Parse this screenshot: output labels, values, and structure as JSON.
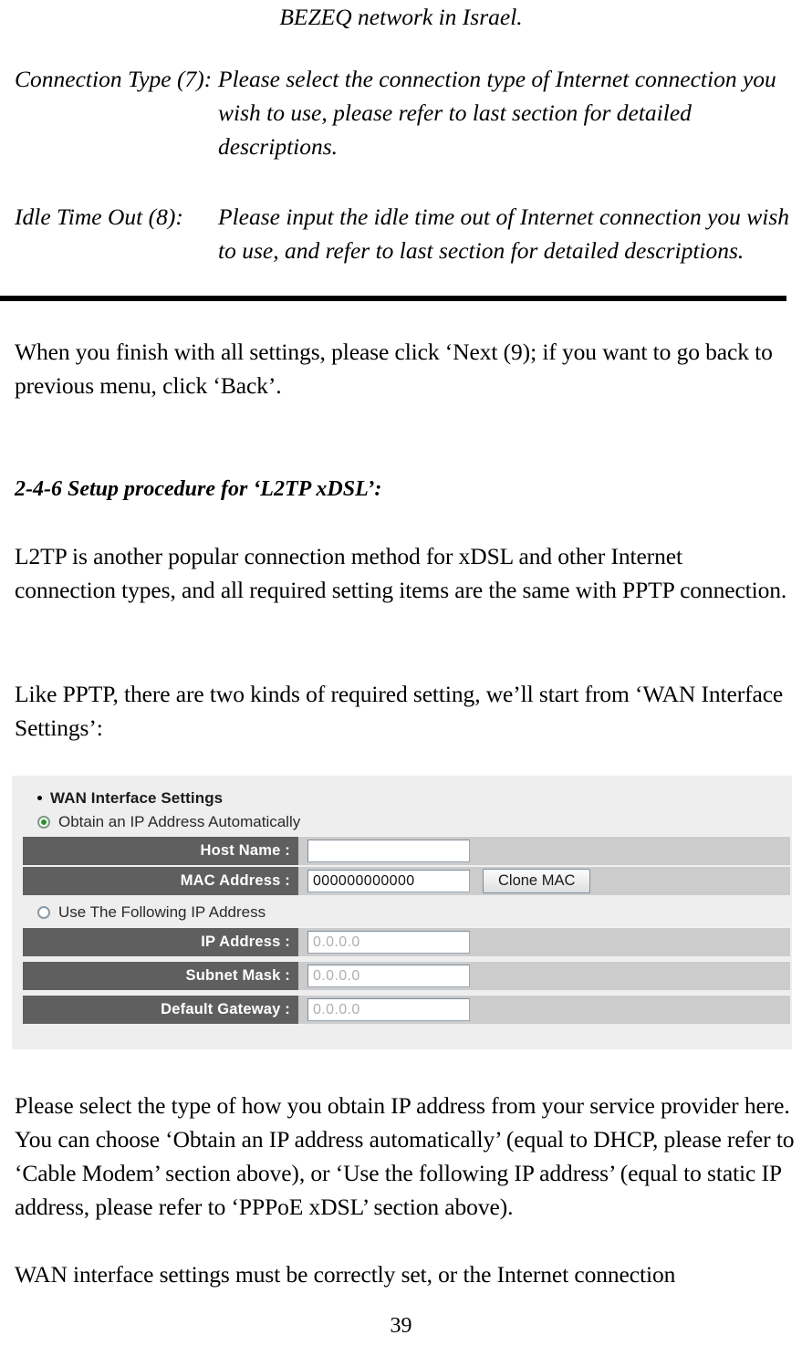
{
  "document": {
    "top_center_line": "BEZEQ network in Israel.",
    "definitions": [
      {
        "term": "Connection Type (7):",
        "description": "Please select the connection type of Internet connection you wish to use, please refer to last section for detailed descriptions."
      },
      {
        "term": "Idle Time Out (8):",
        "description": "Please input the idle time out of Internet connection you wish to use, and refer to last section for detailed descriptions."
      }
    ],
    "paragraph_after_rule": "When you finish with all settings, please click ‘Next (9); if you want to go back to previous menu, click ‘Back’.",
    "section_heading": "2-4-6 Setup procedure for ‘L2TP xDSL’:",
    "paragraph_intro": "L2TP is another popular connection method for xDSL and other Internet connection types, and all required setting items are the same with PPTP connection.",
    "paragraph_like_pptp": "Like PPTP, there are two kinds of required setting, we’ll start from ‘WAN Interface Settings’:",
    "paragraph_explain": "Please select the type of how you obtain IP address from your service provider here. You can choose ‘Obtain an IP address automatically’ (equal to DHCP, please refer to ‘Cable Modem’ section above), or ‘Use the following IP address’ (equal to static IP address, please refer to ‘PPPoE xDSL’ section above).",
    "paragraph_warning": "WAN interface settings must be correctly set, or the Internet connection",
    "page_number": "39"
  },
  "screenshot": {
    "section_title": "WAN Interface Settings",
    "option_auto": {
      "label": "Obtain an IP Address Automatically",
      "selected": true
    },
    "option_static": {
      "label": "Use The Following IP Address",
      "selected": false
    },
    "fields_auto": [
      {
        "label": "Host Name :",
        "value": "",
        "dim": false
      },
      {
        "label": "MAC Address :",
        "value": "000000000000",
        "dim": false
      }
    ],
    "fields_static": [
      {
        "label": "IP Address :",
        "value": "0.0.0.0",
        "dim": true
      },
      {
        "label": "Subnet Mask :",
        "value": "0.0.0.0",
        "dim": true
      },
      {
        "label": "Default Gateway :",
        "value": "0.0.0.0",
        "dim": true
      }
    ],
    "clone_mac_button": "Clone MAC",
    "colors": {
      "panel_background": "#eeeeee",
      "row_background": "#cccccc",
      "label_cell": "#5f5f5f",
      "label_text": "#ffffff",
      "radio_selected_dot": "#2a8f2a",
      "input_background": "#ffffff",
      "input_dim_text": "#b0b0b0"
    }
  }
}
